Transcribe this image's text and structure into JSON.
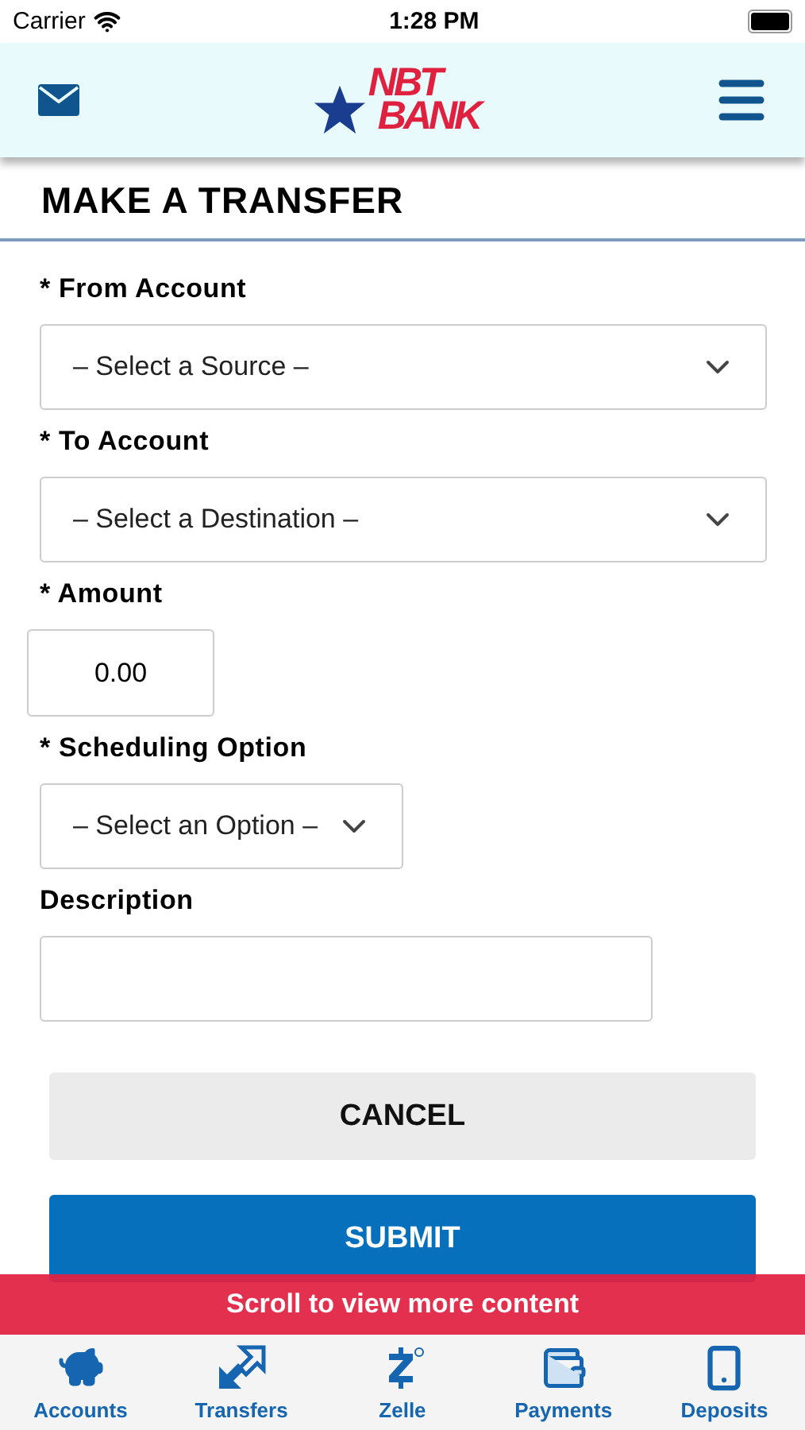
{
  "status_bar": {
    "carrier": "Carrier",
    "time": "1:28 PM"
  },
  "header": {
    "logo": [
      "NBT",
      "BANK"
    ]
  },
  "title": "MAKE A TRANSFER",
  "fields": [
    {
      "kind": "select",
      "label": "* From Account",
      "value": "– Select a Source –"
    },
    {
      "kind": "select",
      "label": "* To Account",
      "value": "– Select a Destination –"
    },
    {
      "kind": "amount",
      "label": "* Amount",
      "value": "0.00"
    },
    {
      "kind": "short-select",
      "label": "* Scheduling Option",
      "value": "– Select an Option –"
    },
    {
      "kind": "text",
      "label": "Description"
    }
  ],
  "buttons": [
    {
      "kind": "secondary",
      "label": "CANCEL"
    },
    {
      "kind": "primary",
      "label": "SUBMIT"
    }
  ],
  "banner": "Scroll to view more content",
  "tabs": [
    {
      "label": "Accounts"
    },
    {
      "label": "Transfers"
    },
    {
      "label": "Zelle"
    },
    {
      "label": "Payments"
    },
    {
      "label": "Deposits"
    }
  ]
}
